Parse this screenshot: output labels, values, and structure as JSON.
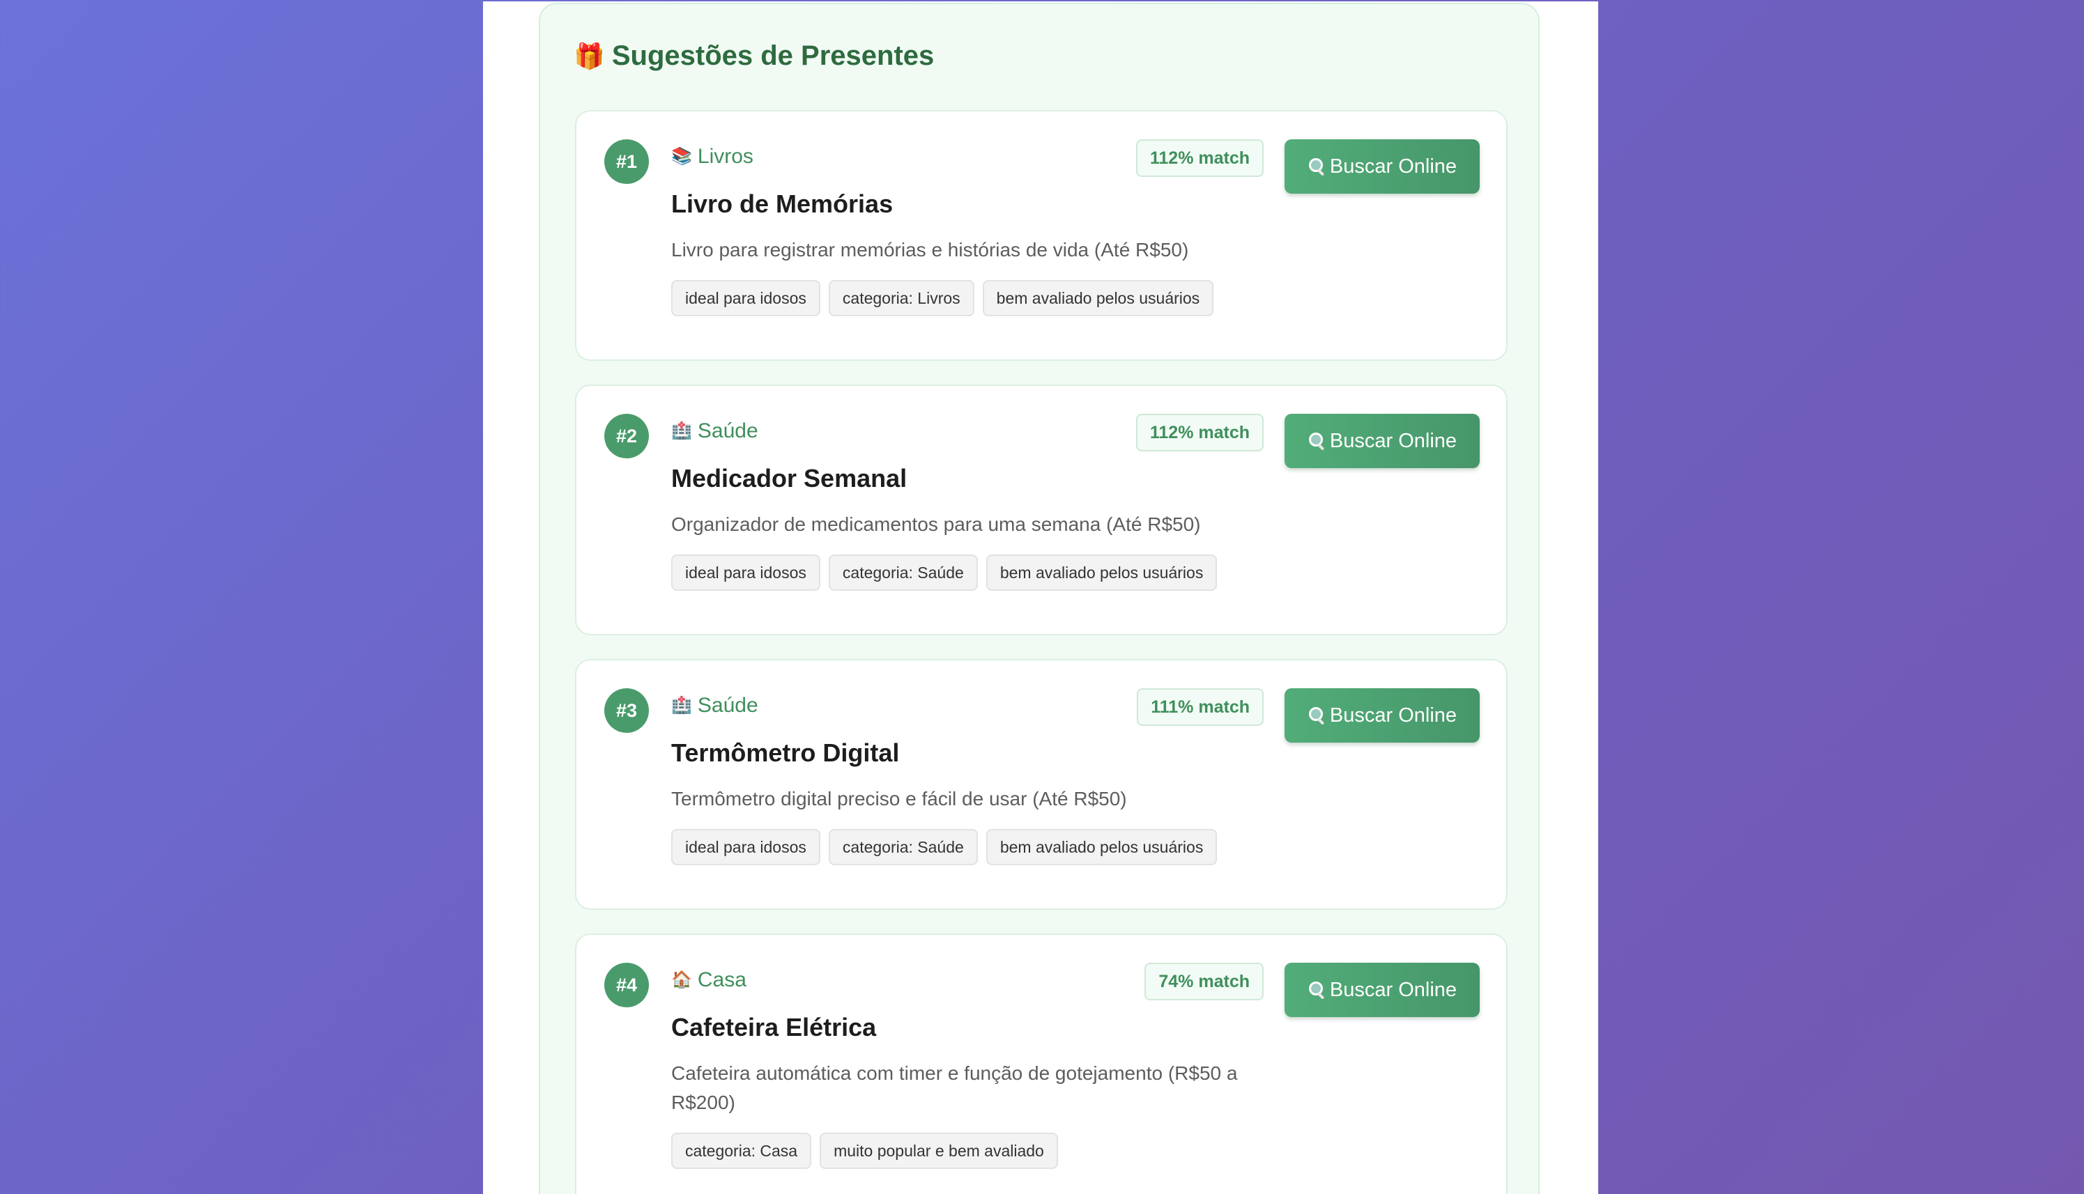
{
  "section": {
    "icon": "gift-icon",
    "emoji": "🎁",
    "title": "Sugestões de Presentes"
  },
  "accent_color": "#4a9b6b",
  "search_icon": "search-icon",
  "cards": [
    {
      "rank": "#1",
      "category_icon": "books-icon",
      "category_emoji": "📚",
      "category": "Livros",
      "match": "112% match",
      "button": "Buscar Online",
      "title": "Livro de Memórias",
      "description": "Livro para registrar memórias e histórias de vida (Até R$50)",
      "tags": [
        "ideal para idosos",
        "categoria: Livros",
        "bem avaliado pelos usuários"
      ]
    },
    {
      "rank": "#2",
      "category_icon": "hospital-icon",
      "category_emoji": "🏥",
      "category": "Saúde",
      "match": "112% match",
      "button": "Buscar Online",
      "title": "Medicador Semanal",
      "description": "Organizador de medicamentos para uma semana (Até R$50)",
      "tags": [
        "ideal para idosos",
        "categoria: Saúde",
        "bem avaliado pelos usuários"
      ]
    },
    {
      "rank": "#3",
      "category_icon": "hospital-icon",
      "category_emoji": "🏥",
      "category": "Saúde",
      "match": "111% match",
      "button": "Buscar Online",
      "title": "Termômetro Digital",
      "description": "Termômetro digital preciso e fácil de usar (Até R$50)",
      "tags": [
        "ideal para idosos",
        "categoria: Saúde",
        "bem avaliado pelos usuários"
      ]
    },
    {
      "rank": "#4",
      "category_icon": "house-icon",
      "category_emoji": "🏠",
      "category": "Casa",
      "match": "74% match",
      "button": "Buscar Online",
      "title": "Cafeteira Elétrica",
      "description": "Cafeteira automática com timer e função de gotejamento (R$50 a R$200)",
      "tags": [
        "categoria: Casa",
        "muito popular e bem avaliado"
      ]
    }
  ]
}
